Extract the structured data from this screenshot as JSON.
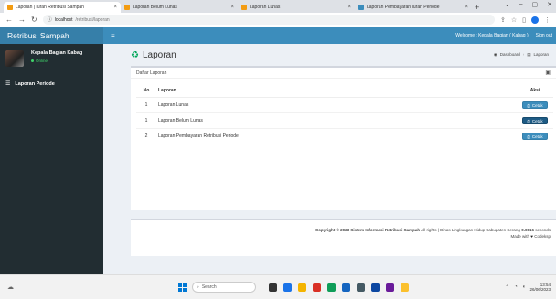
{
  "browser": {
    "tabs": [
      {
        "title": "Laporan | Iuran Retribusi Sampah",
        "active": true
      },
      {
        "title": "Laporan Belum Lunas",
        "active": false
      },
      {
        "title": "Laporan Lunas",
        "active": false
      },
      {
        "title": "Laporan Pembayaran Iuran Periode",
        "active": false
      }
    ],
    "url_host": "localhost",
    "url_path": "/retribusi/laporan"
  },
  "header": {
    "logo": "Retribusi Sampah",
    "welcome": "Welcome : Kepala Bagian ( Kabag )",
    "signout": "Sign out"
  },
  "sidebar": {
    "user_name": "Kepala Bagian Kabag",
    "user_status": "Online",
    "menu": [
      {
        "label": "Laporan Periode"
      }
    ]
  },
  "content": {
    "title": "Laporan",
    "breadcrumb": [
      "Dashboard",
      "Laporan"
    ],
    "box_title": "Daftar Laporan",
    "table": {
      "headers": [
        "No",
        "Laporan",
        "Aksi"
      ],
      "rows": [
        {
          "no": "1",
          "laporan": "Laporan Lunas",
          "aksi": "Cetak"
        },
        {
          "no": "1",
          "laporan": "Laporan Belum Lunas",
          "aksi": "Cetak"
        },
        {
          "no": "2",
          "laporan": "Laporan Pembayaran Retribusi Periode",
          "aksi": "Cetak"
        }
      ]
    }
  },
  "footer": {
    "copyright_label": "Copyright ©",
    "year": "2023",
    "org": "Sistem Informasi Retribusi Sampah",
    "rights": "All rights | Dinas Lingkungan Hidup Kabupaten Serang",
    "time_value": "0.0816",
    "time_unit": "seconds",
    "made_with": "Made with",
    "made_by": "Codeksp"
  },
  "taskbar": {
    "search": "Search",
    "time": "13:54",
    "date": "26/06/2023"
  },
  "colors": {
    "brand": "#3c8dbc",
    "sidebar": "#222d32",
    "online": "#3fd26a"
  }
}
